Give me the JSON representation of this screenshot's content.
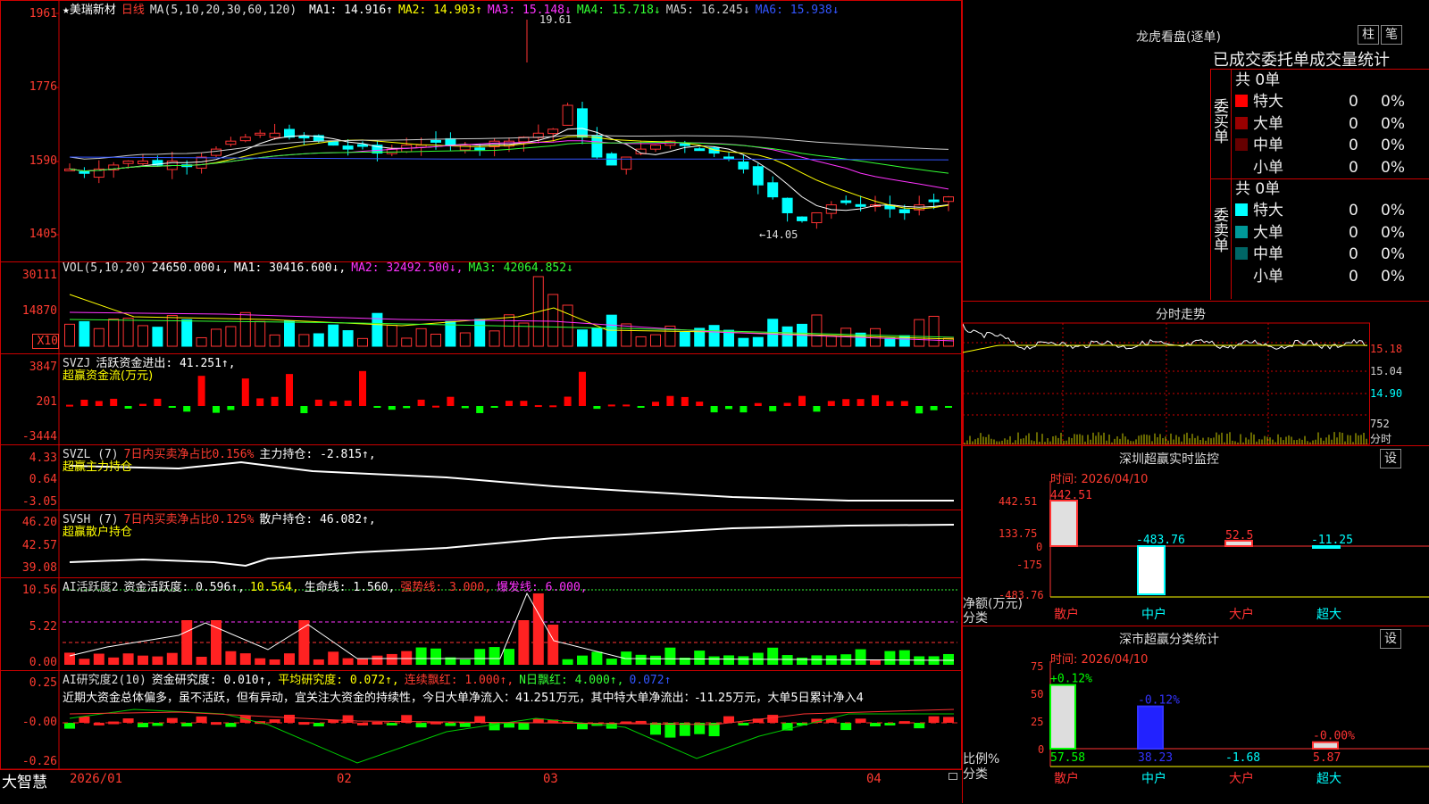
{
  "main_chart": {
    "stock_name": "★美瑞新材",
    "period": "日线",
    "ma_label": "MA(5,10,20,30,60,120)",
    "ma_values": [
      {
        "label": "MA1:",
        "value": "14.916",
        "arrow": "↑",
        "color": "#ffffff"
      },
      {
        "label": "MA2:",
        "value": "14.903",
        "arrow": "↑",
        "color": "#ffff00"
      },
      {
        "label": "MA3:",
        "value": "15.148",
        "arrow": "↓",
        "color": "#ff33ff"
      },
      {
        "label": "MA4:",
        "value": "15.718",
        "arrow": "↓",
        "color": "#33ff33"
      },
      {
        "label": "MA5:",
        "value": "16.245",
        "arrow": "↓",
        "color": "#cccccc"
      },
      {
        "label": "MA6:",
        "value": "15.938",
        "arrow": "↓",
        "color": "#3355ff"
      }
    ],
    "y_ticks": [
      "1961",
      "1776",
      "1590",
      "1405"
    ],
    "high_label": "19.61",
    "low_label": "←14.05"
  },
  "vol_panel": {
    "label": "VOL(5,10,20)",
    "value": "24650.000↓,",
    "ma": [
      {
        "t": "MA1: 30416.600↓,",
        "color": "#ffffff"
      },
      {
        "t": "MA2: 32492.500↓,",
        "color": "#ff33ff"
      },
      {
        "t": "MA3: 42064.852↓",
        "color": "#33ff33"
      }
    ],
    "y_ticks": [
      "30111",
      "14870",
      "X10"
    ]
  },
  "svzj_panel": {
    "label": "SVZJ",
    "text": "活跃资金进出: 41.251↑,",
    "sub": "超赢资金流(万元)",
    "y_ticks": [
      "3847",
      "201",
      "-3444"
    ]
  },
  "svzl_panel": {
    "label": "SVZL (7)",
    "t1": "7日内买卖净占比0.156%",
    "t2": "主力持仓: -2.815↑,",
    "sub": "超赢主力持仓",
    "y_ticks": [
      "4.33",
      "0.64",
      "-3.05"
    ]
  },
  "svsh_panel": {
    "label": "SVSH (7)",
    "t1": "7日内买卖净占比0.125%",
    "t2": "散户持仓: 46.082↑,",
    "sub": "超赢散户持仓",
    "y_ticks": [
      "46.20",
      "42.57",
      "39.08"
    ]
  },
  "ai_active_panel": {
    "label": "AI活跃度2",
    "t1": "资金活跃度: 0.596↑,",
    "t2": "10.564,",
    "t3": "生命线: 1.560,",
    "t4": "强势线: 3.000,",
    "t5": "爆发线: 6.000,",
    "y_ticks": [
      "10.56",
      "5.22",
      "0.00"
    ]
  },
  "ai_research_panel": {
    "label": "AI研究度2(10)",
    "t1": "资金研究度: 0.010↑,",
    "t2": "平均研究度: 0.072↑,",
    "t3": "连续飘红: 1.000↑,",
    "t4": "N日飘红: 4.000↑,",
    "t5": "0.072↑",
    "y_ticks": [
      "0.25",
      "-0.00",
      "-0.26"
    ],
    "comment": "近期大资金总体偏多，虽不活跃，但有异动，宜关注大资金的持续性，今日大单净流入：41.251万元，其中特大单净流出：-11.25万元，大单5日累计净入4"
  },
  "bottom_axis": {
    "brand": "大智慧",
    "dates": [
      "2026/01",
      "02",
      "03",
      "04"
    ]
  },
  "lhb": {
    "title": "龙虎看盘(逐单)",
    "btn1": "柱",
    "btn2": "笔",
    "header": "已成交委托单成交量统计",
    "buy_label": "委买单",
    "sell_label": "委卖单",
    "buy_total": "共 0单",
    "sell_total": "共 0单",
    "buy_rows": [
      {
        "name": "特大",
        "count": "0",
        "pct": "0%",
        "color": "#ff0000"
      },
      {
        "name": "大单",
        "count": "0",
        "pct": "0%",
        "color": "#990000"
      },
      {
        "name": "中单",
        "count": "0",
        "pct": "0%",
        "color": "#660000"
      },
      {
        "name": "小单",
        "count": "0",
        "pct": "0%",
        "color": "#000000"
      }
    ],
    "sell_rows": [
      {
        "name": "特大",
        "count": "0",
        "pct": "0%",
        "color": "#00ffff"
      },
      {
        "name": "大单",
        "count": "0",
        "pct": "0%",
        "color": "#009999"
      },
      {
        "name": "中单",
        "count": "0",
        "pct": "0%",
        "color": "#006666"
      },
      {
        "name": "小单",
        "count": "0",
        "pct": "0%",
        "color": "#000000"
      }
    ]
  },
  "intraday": {
    "title": "分时走势",
    "y_ticks": [
      "15.18",
      "15.04",
      "14.90"
    ],
    "vol_ticks": [
      "752",
      "分时"
    ]
  },
  "sz_monitor": {
    "title": "深圳超赢实时监控",
    "settings": "设",
    "time": "时间: 2026/04/10",
    "y_ticks": [
      "442.51",
      "133.75",
      "0",
      "-175",
      "-483.76"
    ],
    "y_label": "净额(万元)",
    "x_label": "分类",
    "bars": [
      {
        "cat": "散户",
        "value": 442.51,
        "label": "442.51"
      },
      {
        "cat": "中户",
        "value": -483.76,
        "label": "-483.76"
      },
      {
        "cat": "大户",
        "value": 52.5,
        "label": "52.5"
      },
      {
        "cat": "超大",
        "value": -11.25,
        "label": "-11.25"
      }
    ]
  },
  "sz_stat": {
    "title": "深市超赢分类统计",
    "settings": "设",
    "time": "时间: 2026/04/10",
    "y_ticks": [
      "75",
      "50",
      "25",
      "0"
    ],
    "y_label": "比例%",
    "x_label": "分类",
    "bars": [
      {
        "cat": "散户",
        "top": "+0.12%",
        "bottom": "57.58",
        "value": 57.58
      },
      {
        "cat": "中户",
        "top": "-0.12%",
        "bottom": "38.23",
        "value": 38.23
      },
      {
        "cat": "大户",
        "top": "",
        "bottom": "-1.68",
        "value": 0
      },
      {
        "cat": "超大",
        "top": "-0.00%",
        "bottom": "5.87",
        "value": 5.87
      }
    ]
  }
}
